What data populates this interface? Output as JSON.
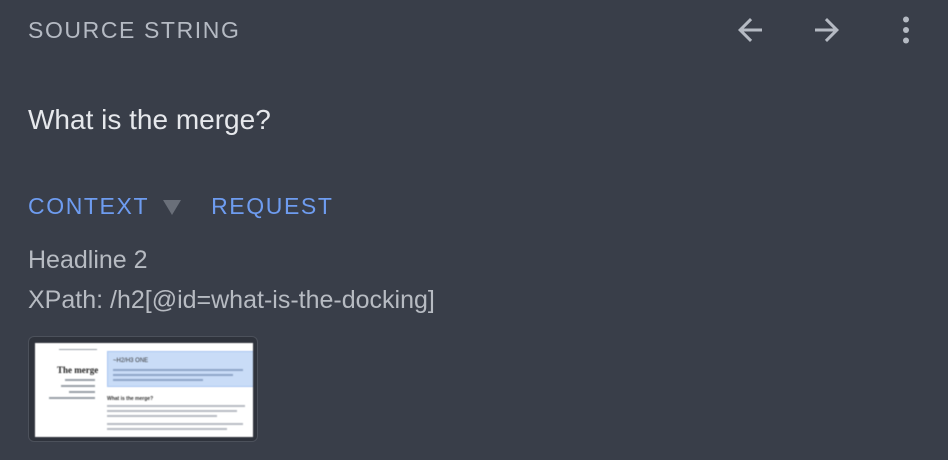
{
  "header": {
    "label": "SOURCE STRING",
    "back_icon": "arrow-left-icon",
    "forward_icon": "arrow-right-icon",
    "menu_icon": "more-vertical-icon"
  },
  "source": {
    "text": "What is the merge?"
  },
  "tabs": [
    {
      "label": "CONTEXT"
    },
    {
      "label": "REQUEST"
    }
  ],
  "context": {
    "element_type": "Headline 2",
    "xpath": "XPath: /h2[@id=what-is-the-docking]"
  },
  "thumbnail": {
    "heading": "The merge",
    "highlight_title": "~H2/H3 ONE",
    "subheading": "What is the merge?"
  },
  "colors": {
    "background": "#393e49",
    "accent": "#6e9cf0",
    "muted_text": "#b5bac3",
    "primary_text": "#e6e8ec"
  }
}
